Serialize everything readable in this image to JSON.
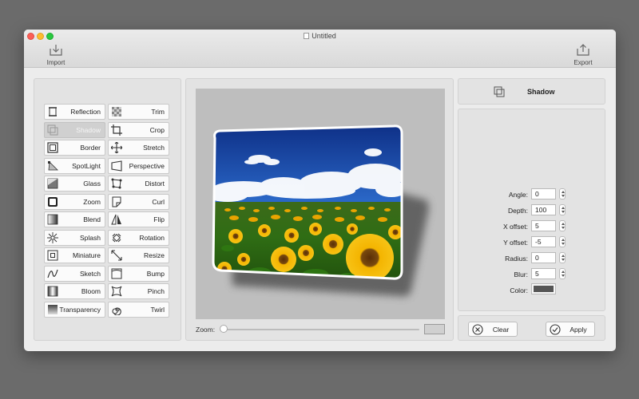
{
  "window": {
    "title": "Untitled"
  },
  "toolbar": {
    "import_label": "Import",
    "export_label": "Export"
  },
  "effects": [
    {
      "label": "Reflection",
      "icon": "reflection-icon",
      "selected": false
    },
    {
      "label": "Trim",
      "icon": "trim-icon",
      "selected": false
    },
    {
      "label": "Shadow",
      "icon": "shadow-icon",
      "selected": true
    },
    {
      "label": "Crop",
      "icon": "crop-icon",
      "selected": false
    },
    {
      "label": "Border",
      "icon": "border-icon",
      "selected": false
    },
    {
      "label": "Stretch",
      "icon": "stretch-icon",
      "selected": false
    },
    {
      "label": "SpotLight",
      "icon": "spotlight-icon",
      "selected": false
    },
    {
      "label": "Perspective",
      "icon": "perspective-icon",
      "selected": false
    },
    {
      "label": "Glass",
      "icon": "glass-icon",
      "selected": false
    },
    {
      "label": "Distort",
      "icon": "distort-icon",
      "selected": false
    },
    {
      "label": "Zoom",
      "icon": "zoom-icon",
      "selected": false
    },
    {
      "label": "Curl",
      "icon": "curl-icon",
      "selected": false
    },
    {
      "label": "Blend",
      "icon": "blend-icon",
      "selected": false
    },
    {
      "label": "Flip",
      "icon": "flip-icon",
      "selected": false
    },
    {
      "label": "Splash",
      "icon": "splash-icon",
      "selected": false
    },
    {
      "label": "Rotation",
      "icon": "rotation-icon",
      "selected": false
    },
    {
      "label": "Miniature",
      "icon": "miniature-icon",
      "selected": false
    },
    {
      "label": "Resize",
      "icon": "resize-icon",
      "selected": false
    },
    {
      "label": "Sketch",
      "icon": "sketch-icon",
      "selected": false
    },
    {
      "label": "Bump",
      "icon": "bump-icon",
      "selected": false
    },
    {
      "label": "Bloom",
      "icon": "bloom-icon",
      "selected": false
    },
    {
      "label": "Pinch",
      "icon": "pinch-icon",
      "selected": false
    },
    {
      "label": "Transparency",
      "icon": "transparency-icon",
      "selected": false
    },
    {
      "label": "Twirl",
      "icon": "twirl-icon",
      "selected": false
    }
  ],
  "preview": {
    "zoom_label": "Zoom:",
    "zoom_level": 0.0
  },
  "inspector": {
    "title": "Shadow",
    "fields": [
      {
        "label": "Angle:",
        "value": "0"
      },
      {
        "label": "Depth:",
        "value": "100"
      },
      {
        "label": "X offset:",
        "value": "5"
      },
      {
        "label": "Y offset:",
        "value": "-5"
      },
      {
        "label": "Radius:",
        "value": "0"
      },
      {
        "label": "Blur:",
        "value": "5"
      }
    ],
    "color_label": "Color:",
    "color_value": "#555555"
  },
  "actions": {
    "clear_label": "Clear",
    "apply_label": "Apply"
  }
}
